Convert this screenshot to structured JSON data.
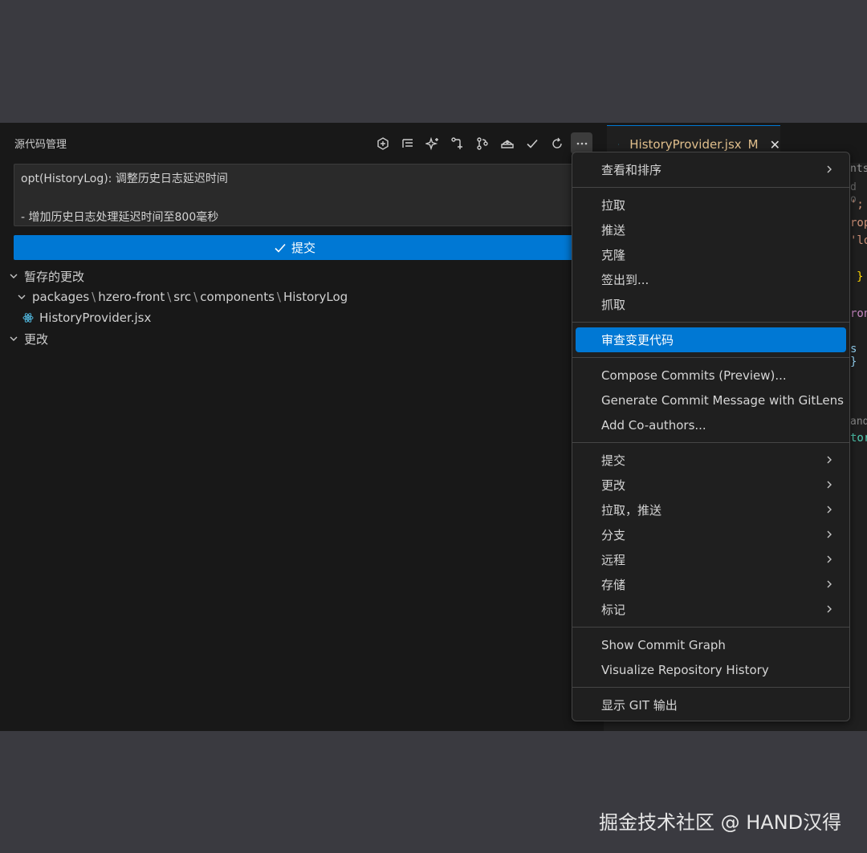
{
  "scm": {
    "title": "源代码管理",
    "commit_message": {
      "line1": "opt(HistoryLog): 调整历史日志延迟时间",
      "line2": "- 增加历史日志处理延迟时间至800毫秒"
    },
    "commit_button": "提交",
    "staged_group": "暂存的更改",
    "folder_path": [
      "packages",
      "hzero-front",
      "src",
      "components",
      "HistoryLog"
    ],
    "staged_file": "HistoryProvider.jsx",
    "changes_group": "更改"
  },
  "editor": {
    "tab_name": "HistoryProvider.jsx",
    "tab_status": "M",
    "tab_close": "✕",
    "code_fragments": [
      "nts",
      "d o",
      "';",
      "rop",
      "'lo",
      "}",
      "ron",
      "s }",
      "and",
      "tor"
    ]
  },
  "menu": {
    "view_sort": "查看和排序",
    "pull": "拉取",
    "push": "推送",
    "clone": "克隆",
    "checkout": "签出到...",
    "fetch": "抓取",
    "review": "审查变更代码",
    "compose": "Compose Commits (Preview)...",
    "generate": "Generate Commit Message with GitLens",
    "coauthors": "Add Co-authors...",
    "commit": "提交",
    "changes": "更改",
    "pull_push": "拉取，推送",
    "branch": "分支",
    "remote": "远程",
    "stash": "存储",
    "tags": "标记",
    "commit_graph": "Show Commit Graph",
    "visualize": "Visualize Repository History",
    "git_output": "显示 GIT 输出"
  },
  "watermark": "掘金技术社区 @ HAND汉得",
  "colors": {
    "accent": "#0078d4",
    "modified": "#e2c08d"
  }
}
